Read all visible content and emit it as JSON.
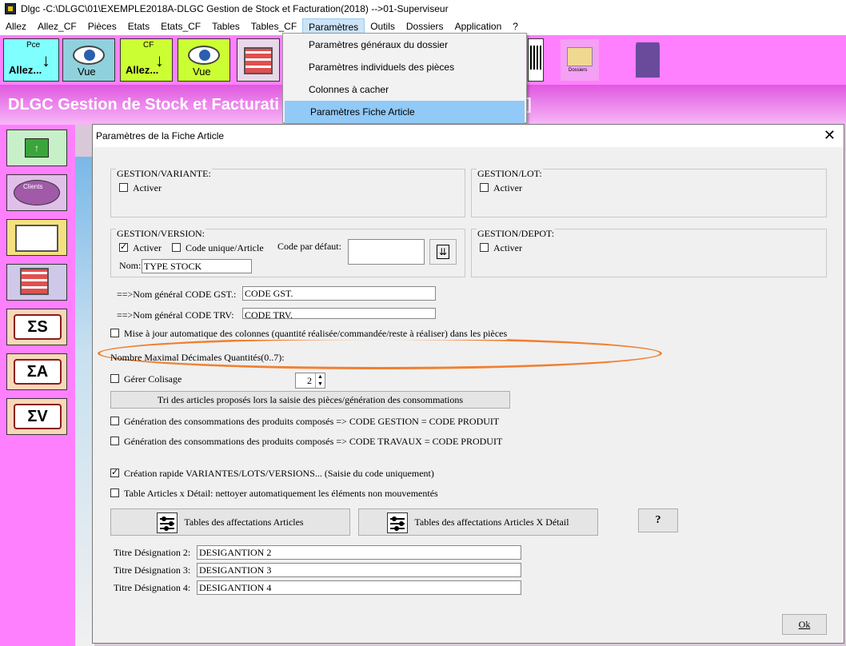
{
  "window": {
    "title": "Dlgc -C:\\DLGC\\01\\EXEMPLE2018A-DLGC Gestion de Stock et Facturation(2018) -->01-Superviseur"
  },
  "menu": [
    "Allez",
    "Allez_CF",
    "Pièces",
    "Etats",
    "Etats_CF",
    "Tables",
    "Tables_CF",
    "Paramètres",
    "Outils",
    "Dossiers",
    "Application",
    "?"
  ],
  "toolbar": {
    "allez_small": "Pce",
    "allez_label": "Allez...",
    "vue_label": "Vue",
    "allez_cf_small": "CF",
    "allez_cf_label": "Allez...",
    "vue2_label": "Vue",
    "dossiers_label": "Dossiers"
  },
  "banner": {
    "text": "DLGC Gestion de Stock et Facturati",
    "tail": "]"
  },
  "sidebar": {
    "clients_label": "Clients"
  },
  "dropdown": [
    "Paramètres généraux du dossier",
    "Paramètres individuels des pièces",
    "Colonnes à cacher",
    "Paramètres Fiche Article"
  ],
  "dialog": {
    "title": "Paramètres de la Fiche Article",
    "close": "✕",
    "gestion_variante": {
      "title": "GESTION/VARIANTE:",
      "activer": "Activer"
    },
    "gestion_lot": {
      "title": "GESTION/LOT:",
      "activer": "Activer"
    },
    "gestion_version": {
      "title": "GESTION/VERSION:",
      "activer": "Activer",
      "code_unique": "Code unique/Article",
      "code_defaut_label": "Code par défaut:",
      "code_defaut_value": "",
      "nom_label": "Nom:",
      "nom_value": "TYPE STOCK"
    },
    "gestion_depot": {
      "title": "GESTION/DEPOT:",
      "activer": "Activer"
    },
    "code_gst_label": "==>Nom général CODE GST.:",
    "code_gst_value": "CODE GST.",
    "code_trv_label": "==>Nom général CODE TRV:",
    "code_trv_value": "CODE TRV.",
    "maj_auto": "Mise à jour automatique des colonnes (quantité réalisée/commandée/reste à réaliser) dans les pièces",
    "nb_decimales_label": "Nombre Maximal Décimales Quantités(0..7):",
    "nb_decimales_value": "2",
    "colisage": "Gérer Colisage",
    "tri_button": "Tri des articles proposés lors la saisie des pièces/génération des consommations",
    "gen_gestion": "Génération des consommations des produits composés => CODE GESTION = CODE PRODUIT",
    "gen_travaux": "Génération des consommations des produits composés => CODE TRAVAUX = CODE PRODUIT",
    "creation_rapide": "Création rapide VARIANTES/LOTS/VERSIONS... (Saisie du code uniquement)",
    "table_detail": "Table Articles x Détail: nettoyer automatiquement les éléments non mouvementés",
    "aff_articles_button": "Tables des affectations Articles",
    "aff_detail_button": "Tables des affectations Articles X Détail",
    "help_button": "?",
    "titre2_label": "Titre Désignation 2:",
    "titre2_value": "DESIGANTION 2",
    "titre3_label": "Titre Désignation 3:",
    "titre3_value": "DESIGANTION 3",
    "titre4_label": "Titre Désignation 4:",
    "titre4_value": "DESIGANTION 4",
    "ok_button": "Ok"
  }
}
